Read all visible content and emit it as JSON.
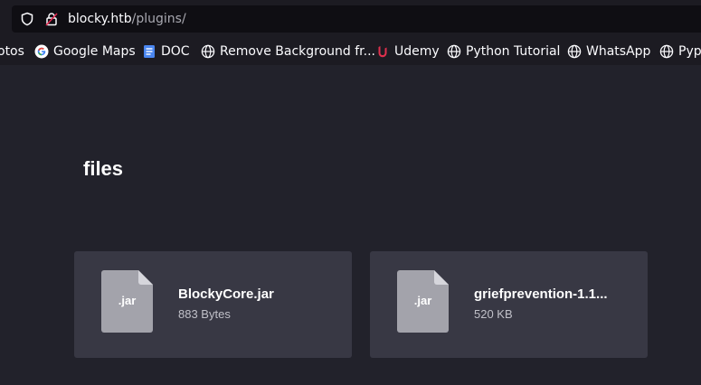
{
  "browser": {
    "url_host": "blocky.htb",
    "url_path": "/plugins/"
  },
  "bookmarks": [
    {
      "label": "otos",
      "icon": "none"
    },
    {
      "label": "Google Maps",
      "icon": "google-icon"
    },
    {
      "label": "DOC",
      "icon": "document-icon"
    },
    {
      "label": "Remove Background fr...",
      "icon": "globe-icon"
    },
    {
      "label": "Udemy",
      "icon": "udemy-icon"
    },
    {
      "label": "Python Tutorial",
      "icon": "globe-icon"
    },
    {
      "label": "WhatsApp",
      "icon": "globe-icon"
    },
    {
      "label": "Pypi",
      "icon": "globe-icon"
    }
  ],
  "page": {
    "heading": "files"
  },
  "files": [
    {
      "ext": ".jar",
      "name": "BlockyCore.jar",
      "size": "883 Bytes"
    },
    {
      "ext": ".jar",
      "name": "griefprevention-1.1...",
      "size": "520 KB"
    }
  ],
  "colors": {
    "background": "#22222b",
    "card": "#383844",
    "file_icon": "#a3a3ab",
    "urlbar": "#0f0e13"
  }
}
